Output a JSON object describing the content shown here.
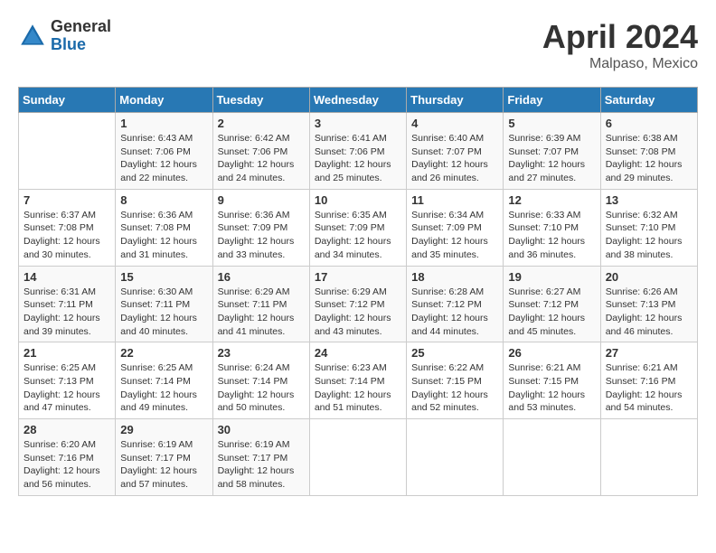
{
  "header": {
    "logo_general": "General",
    "logo_blue": "Blue",
    "title": "April 2024",
    "location": "Malpaso, Mexico"
  },
  "days_of_week": [
    "Sunday",
    "Monday",
    "Tuesday",
    "Wednesday",
    "Thursday",
    "Friday",
    "Saturday"
  ],
  "weeks": [
    [
      {
        "day": "",
        "info": ""
      },
      {
        "day": "1",
        "info": "Sunrise: 6:43 AM\nSunset: 7:06 PM\nDaylight: 12 hours\nand 22 minutes."
      },
      {
        "day": "2",
        "info": "Sunrise: 6:42 AM\nSunset: 7:06 PM\nDaylight: 12 hours\nand 24 minutes."
      },
      {
        "day": "3",
        "info": "Sunrise: 6:41 AM\nSunset: 7:06 PM\nDaylight: 12 hours\nand 25 minutes."
      },
      {
        "day": "4",
        "info": "Sunrise: 6:40 AM\nSunset: 7:07 PM\nDaylight: 12 hours\nand 26 minutes."
      },
      {
        "day": "5",
        "info": "Sunrise: 6:39 AM\nSunset: 7:07 PM\nDaylight: 12 hours\nand 27 minutes."
      },
      {
        "day": "6",
        "info": "Sunrise: 6:38 AM\nSunset: 7:08 PM\nDaylight: 12 hours\nand 29 minutes."
      }
    ],
    [
      {
        "day": "7",
        "info": "Sunrise: 6:37 AM\nSunset: 7:08 PM\nDaylight: 12 hours\nand 30 minutes."
      },
      {
        "day": "8",
        "info": "Sunrise: 6:36 AM\nSunset: 7:08 PM\nDaylight: 12 hours\nand 31 minutes."
      },
      {
        "day": "9",
        "info": "Sunrise: 6:36 AM\nSunset: 7:09 PM\nDaylight: 12 hours\nand 33 minutes."
      },
      {
        "day": "10",
        "info": "Sunrise: 6:35 AM\nSunset: 7:09 PM\nDaylight: 12 hours\nand 34 minutes."
      },
      {
        "day": "11",
        "info": "Sunrise: 6:34 AM\nSunset: 7:09 PM\nDaylight: 12 hours\nand 35 minutes."
      },
      {
        "day": "12",
        "info": "Sunrise: 6:33 AM\nSunset: 7:10 PM\nDaylight: 12 hours\nand 36 minutes."
      },
      {
        "day": "13",
        "info": "Sunrise: 6:32 AM\nSunset: 7:10 PM\nDaylight: 12 hours\nand 38 minutes."
      }
    ],
    [
      {
        "day": "14",
        "info": "Sunrise: 6:31 AM\nSunset: 7:11 PM\nDaylight: 12 hours\nand 39 minutes."
      },
      {
        "day": "15",
        "info": "Sunrise: 6:30 AM\nSunset: 7:11 PM\nDaylight: 12 hours\nand 40 minutes."
      },
      {
        "day": "16",
        "info": "Sunrise: 6:29 AM\nSunset: 7:11 PM\nDaylight: 12 hours\nand 41 minutes."
      },
      {
        "day": "17",
        "info": "Sunrise: 6:29 AM\nSunset: 7:12 PM\nDaylight: 12 hours\nand 43 minutes."
      },
      {
        "day": "18",
        "info": "Sunrise: 6:28 AM\nSunset: 7:12 PM\nDaylight: 12 hours\nand 44 minutes."
      },
      {
        "day": "19",
        "info": "Sunrise: 6:27 AM\nSunset: 7:12 PM\nDaylight: 12 hours\nand 45 minutes."
      },
      {
        "day": "20",
        "info": "Sunrise: 6:26 AM\nSunset: 7:13 PM\nDaylight: 12 hours\nand 46 minutes."
      }
    ],
    [
      {
        "day": "21",
        "info": "Sunrise: 6:25 AM\nSunset: 7:13 PM\nDaylight: 12 hours\nand 47 minutes."
      },
      {
        "day": "22",
        "info": "Sunrise: 6:25 AM\nSunset: 7:14 PM\nDaylight: 12 hours\nand 49 minutes."
      },
      {
        "day": "23",
        "info": "Sunrise: 6:24 AM\nSunset: 7:14 PM\nDaylight: 12 hours\nand 50 minutes."
      },
      {
        "day": "24",
        "info": "Sunrise: 6:23 AM\nSunset: 7:14 PM\nDaylight: 12 hours\nand 51 minutes."
      },
      {
        "day": "25",
        "info": "Sunrise: 6:22 AM\nSunset: 7:15 PM\nDaylight: 12 hours\nand 52 minutes."
      },
      {
        "day": "26",
        "info": "Sunrise: 6:21 AM\nSunset: 7:15 PM\nDaylight: 12 hours\nand 53 minutes."
      },
      {
        "day": "27",
        "info": "Sunrise: 6:21 AM\nSunset: 7:16 PM\nDaylight: 12 hours\nand 54 minutes."
      }
    ],
    [
      {
        "day": "28",
        "info": "Sunrise: 6:20 AM\nSunset: 7:16 PM\nDaylight: 12 hours\nand 56 minutes."
      },
      {
        "day": "29",
        "info": "Sunrise: 6:19 AM\nSunset: 7:17 PM\nDaylight: 12 hours\nand 57 minutes."
      },
      {
        "day": "30",
        "info": "Sunrise: 6:19 AM\nSunset: 7:17 PM\nDaylight: 12 hours\nand 58 minutes."
      },
      {
        "day": "",
        "info": ""
      },
      {
        "day": "",
        "info": ""
      },
      {
        "day": "",
        "info": ""
      },
      {
        "day": "",
        "info": ""
      }
    ]
  ]
}
